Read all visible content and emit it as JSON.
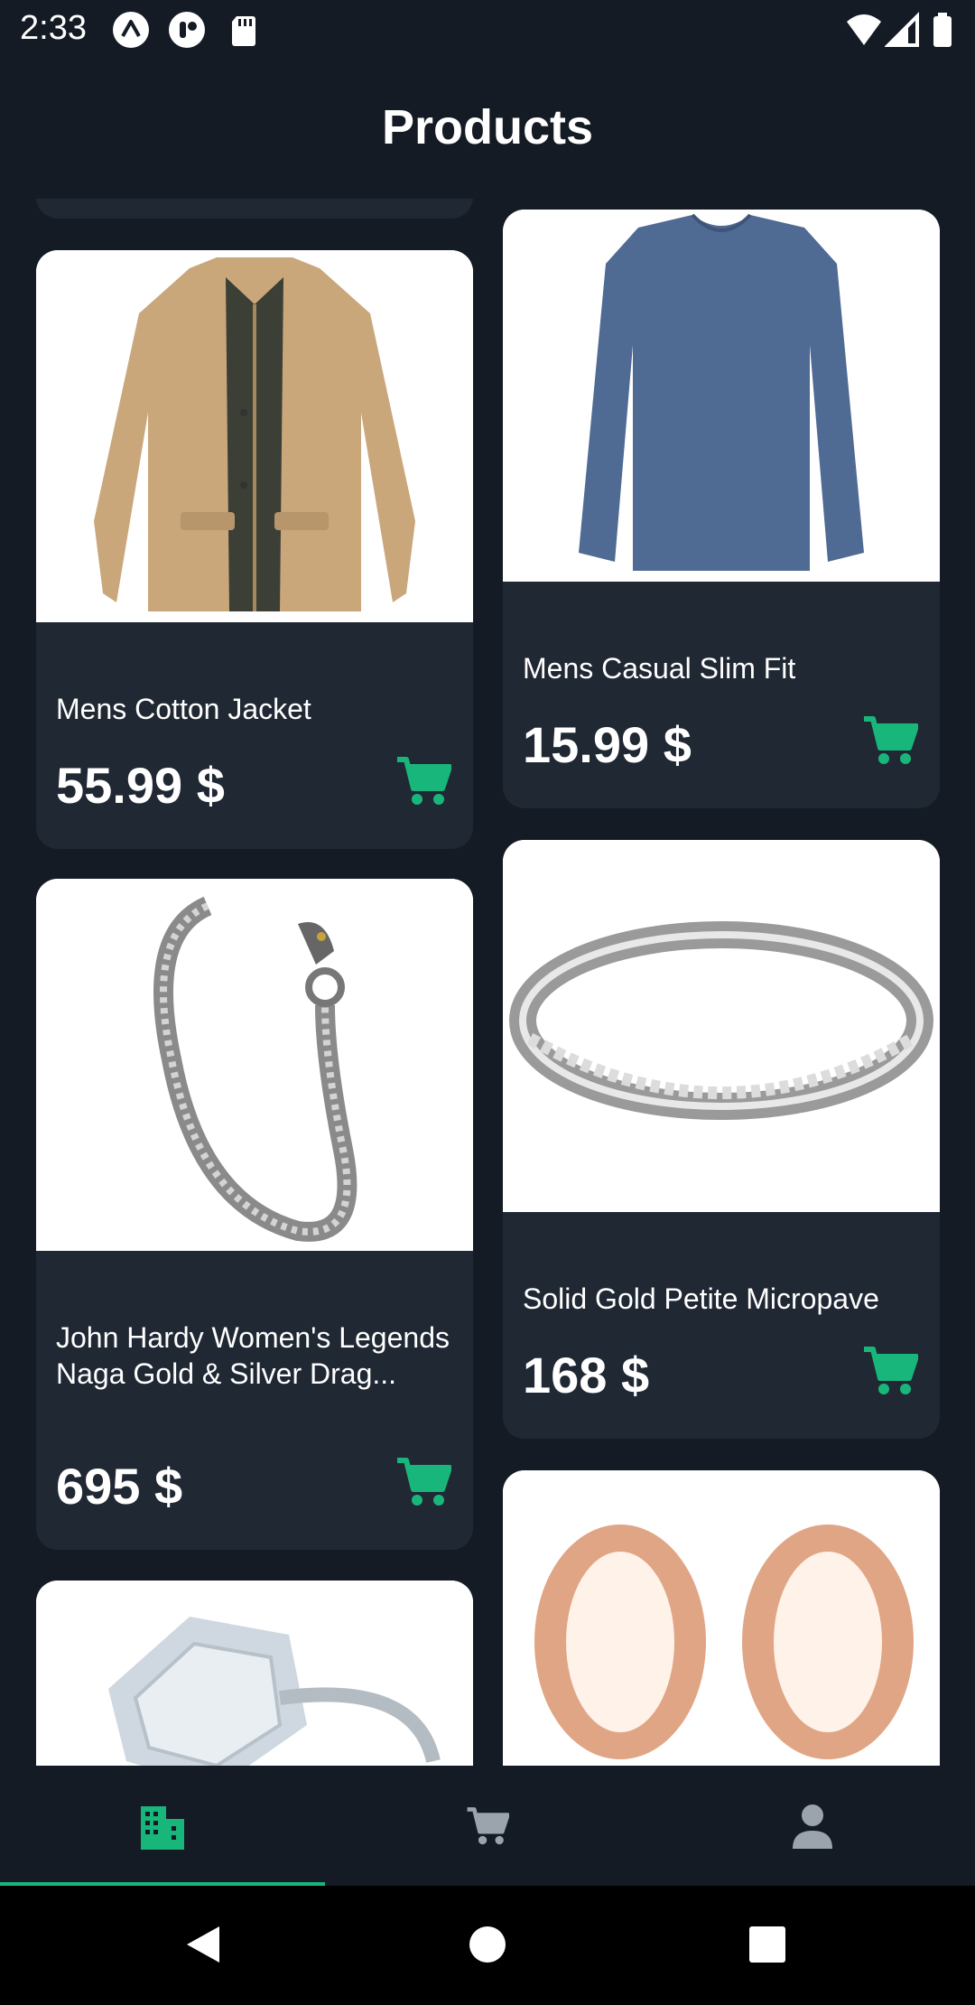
{
  "status_bar": {
    "time": "2:33"
  },
  "header": {
    "title": "Products"
  },
  "products": [
    {
      "title": "Mens Cotton Jacket",
      "price": "55.99 $"
    },
    {
      "title": "Mens Casual Slim Fit",
      "price": "15.99 $"
    },
    {
      "title": "John Hardy Women's Legends Naga Gold & Silver Drag...",
      "price": "695 $"
    },
    {
      "title": "Solid Gold Petite Micropave",
      "price": "168 $"
    }
  ],
  "bottom_nav": {
    "items": [
      {
        "icon": "building-icon",
        "active": true
      },
      {
        "icon": "cart-icon",
        "active": false
      },
      {
        "icon": "person-icon",
        "active": false
      }
    ]
  },
  "colors": {
    "background": "#141b24",
    "card": "#202833",
    "accent": "#19b67b"
  }
}
